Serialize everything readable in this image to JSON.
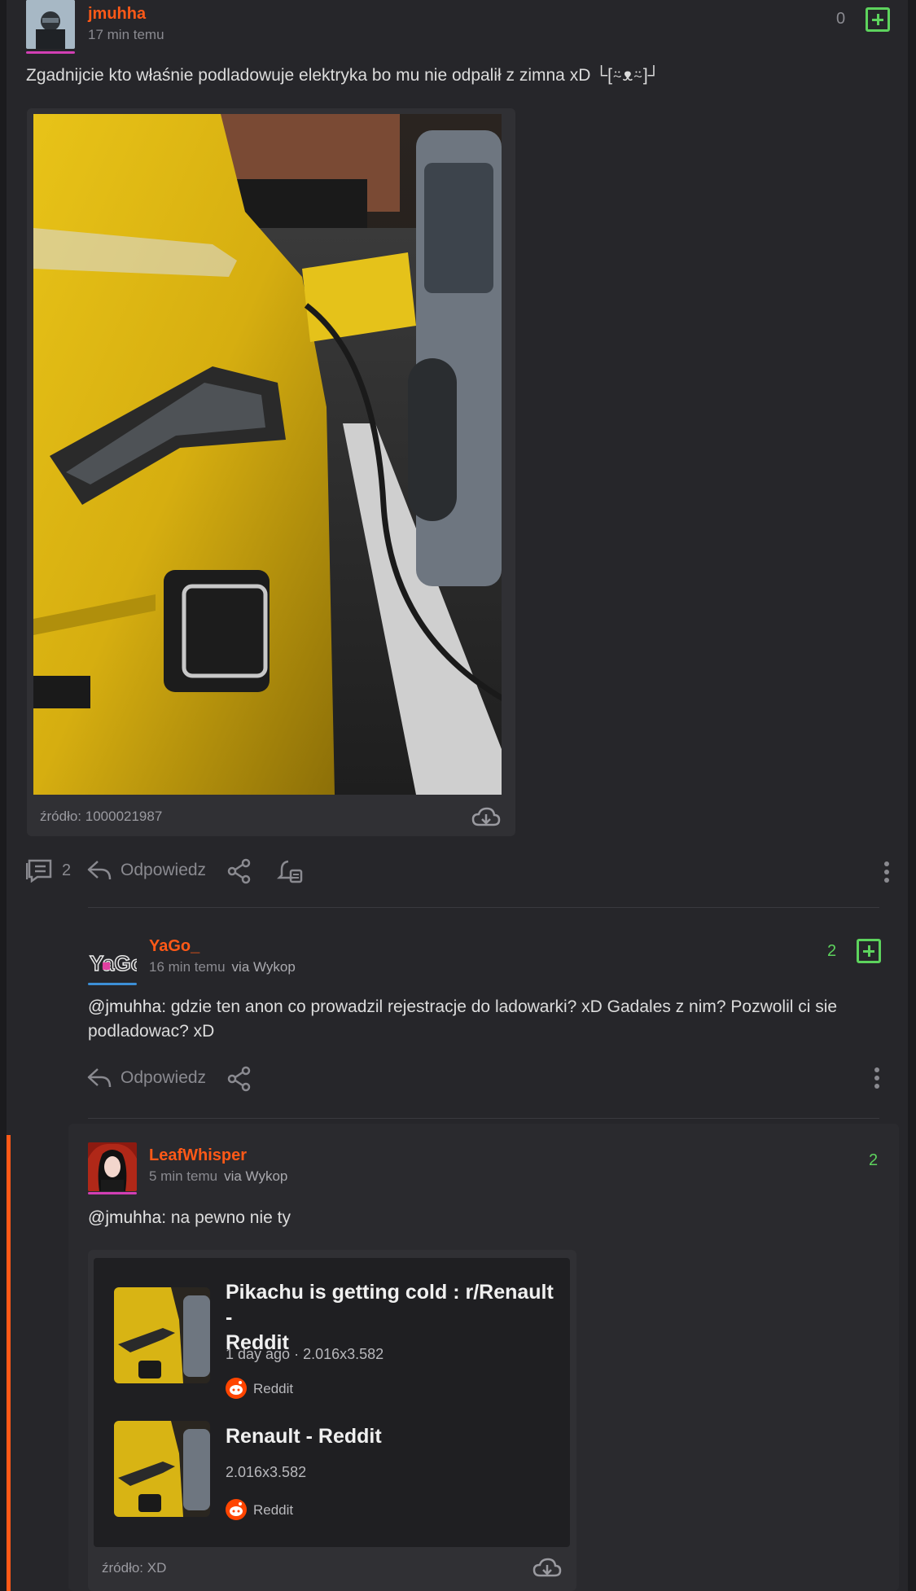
{
  "post": {
    "username": "jmuhha",
    "time": "17 min temu",
    "votes": "0",
    "text": "Zgadnijcie kto właśnie podladowuje elektryka bo mu nie odpalił z zimna xD └[⍨ᴥ⍨]┘",
    "image_source": "źródło: 1000021987",
    "comments_count": "2",
    "reply_label": "Odpowiedz"
  },
  "comments": [
    {
      "username": "YaGo_",
      "time": "16 min temu",
      "via": "via Wykop",
      "votes": "2",
      "mention": "@jmuhha",
      "text_line1": ": gdzie ten anon co prowadzil rejestracje do ladowarki? xD Gadales z nim? Pozwolil ci sie",
      "text_line2": "podladowac? xD",
      "reply_label": "Odpowiedz"
    },
    {
      "username": "LeafWhisper",
      "time": "5 min temu",
      "via": "via Wykop",
      "votes": "2",
      "mention": "@jmuhha",
      "text": ": na pewno nie ty",
      "image_source": "źródło: XD",
      "results": [
        {
          "title_line1": "Pikachu is getting cold : r/Renault -",
          "title_line2": "Reddit",
          "meta": "1 day ago · 2.016x3.582",
          "site": "Reddit"
        },
        {
          "title_line1": "Renault - Reddit",
          "meta": "2.016x3.582",
          "site": "Reddit"
        }
      ]
    }
  ],
  "colors": {
    "accent": "#ff5917",
    "vote_green": "#5dd35d",
    "background": "#26262a"
  }
}
